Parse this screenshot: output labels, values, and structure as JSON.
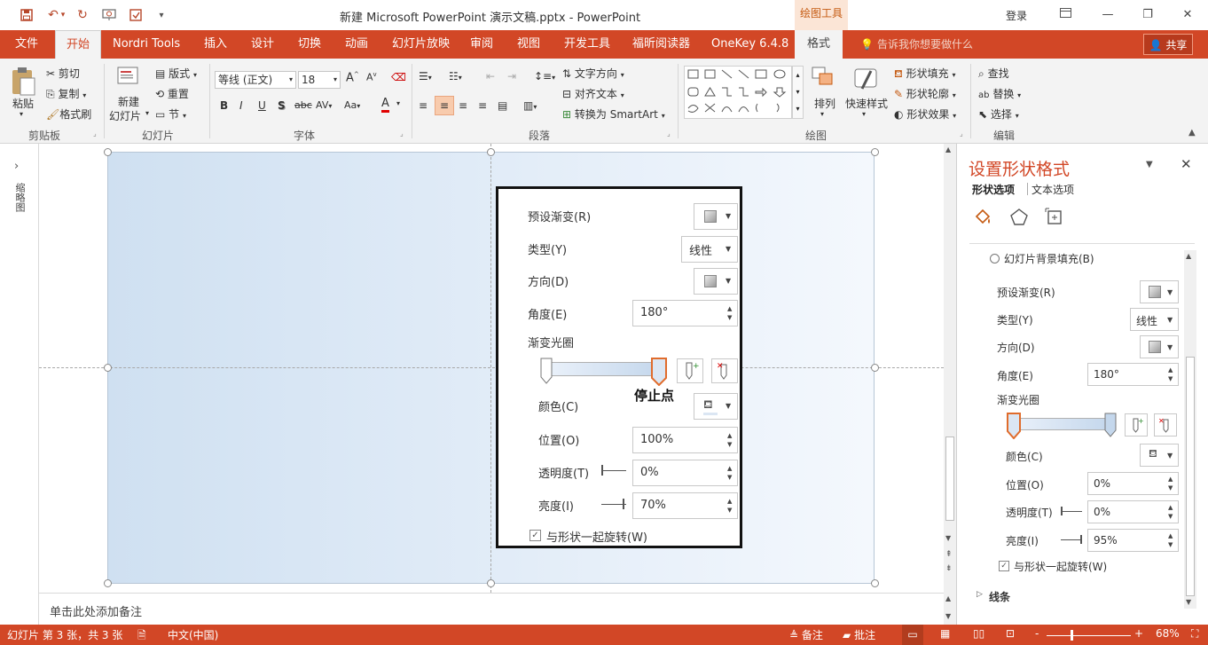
{
  "window": {
    "title": "新建 Microsoft PowerPoint 演示文稿.pptx  -  PowerPoint",
    "drawing_tools": "绘图工具",
    "login": "登录",
    "min": "—",
    "max": "❐",
    "close": "✕"
  },
  "colors": {
    "brand": "#d24726",
    "accent_text": "#c55a11"
  },
  "tabs": [
    {
      "label": "文件"
    },
    {
      "label": "开始"
    },
    {
      "label": "Nordri Tools"
    },
    {
      "label": "插入"
    },
    {
      "label": "设计"
    },
    {
      "label": "切换"
    },
    {
      "label": "动画"
    },
    {
      "label": "幻灯片放映"
    },
    {
      "label": "审阅"
    },
    {
      "label": "视图"
    },
    {
      "label": "开发工具"
    },
    {
      "label": "福昕阅读器"
    },
    {
      "label": "OneKey 6.4.8"
    },
    {
      "label": "格式"
    }
  ],
  "tell_me": "告诉我你想要做什么",
  "share": "共享",
  "ribbon": {
    "clipboard": {
      "paste": "粘贴",
      "cut": "剪切",
      "copy": "复制",
      "painter": "格式刷",
      "group": "剪贴板"
    },
    "slides": {
      "new_line1": "新建",
      "new_line2": "幻灯片",
      "layout": "版式",
      "reset": "重置",
      "section": "节",
      "group": "幻灯片"
    },
    "font": {
      "name": "等线 (正文)",
      "size": "18",
      "bold": "B",
      "italic": "I",
      "underline": "U",
      "shadow": "S",
      "strike": "abc",
      "spacing": "AV",
      "case": "Aa",
      "color": "A",
      "group": "字体"
    },
    "paragraph": {
      "text_dir": "文字方向",
      "align_text": "对齐文本",
      "smartart": "转换为 SmartArt",
      "group": "段落"
    },
    "drawing": {
      "arrange": "排列",
      "quick_styles": "快速样式",
      "fill": "形状填充",
      "outline": "形状轮廓",
      "effects": "形状效果",
      "group": "绘图"
    },
    "editing": {
      "find": "查找",
      "replace": "替换",
      "select": "选择",
      "group": "编辑"
    }
  },
  "thumb_pane": {
    "label": "缩略图"
  },
  "popup": {
    "preset": "预设渐变(R)",
    "type": "类型(Y)",
    "type_value": "线性",
    "direction": "方向(D)",
    "angle": "角度(E)",
    "angle_value": "180°",
    "stops": "渐变光圈",
    "stop_callout": "停止点",
    "color": "颜色(C)",
    "position": "位置(O)",
    "position_value": "100%",
    "transparency": "透明度(T)",
    "transparency_value": "0%",
    "brightness": "亮度(I)",
    "brightness_value": "70%",
    "rotate": "与形状一起旋转(W)"
  },
  "notes": {
    "placeholder": "单击此处添加备注"
  },
  "format_pane": {
    "title": "设置形状格式",
    "tab_shape": "形状选项",
    "tab_text": "文本选项",
    "bg_fill": "幻灯片背景填充(B)",
    "preset": "预设渐变(R)",
    "type": "类型(Y)",
    "type_value": "线性",
    "direction": "方向(D)",
    "angle": "角度(E)",
    "angle_value": "180°",
    "stops": "渐变光圈",
    "color": "颜色(C)",
    "position": "位置(O)",
    "position_value": "0%",
    "transparency": "透明度(T)",
    "transparency_value": "0%",
    "brightness": "亮度(I)",
    "brightness_value": "95%",
    "rotate": "与形状一起旋转(W)",
    "line": "线条"
  },
  "status": {
    "slide": "幻灯片 第 3 张，共 3 张",
    "lang": "中文(中国)",
    "notes": "备注",
    "comments": "批注",
    "zoom": "68%",
    "minus": "-",
    "plus": "+"
  }
}
